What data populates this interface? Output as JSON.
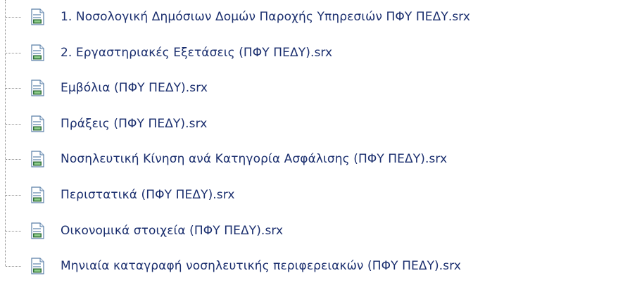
{
  "tree": {
    "items": [
      {
        "label": "1. Νοσολογική Δημόσιων Δομών Παροχής Υπηρεσιών ΠΦΥ ΠΕΔΥ.srx",
        "icon": "report-file-icon"
      },
      {
        "label": "2. Εργαστηριακές Εξετάσεις (ΠΦΥ ΠΕΔΥ).srx",
        "icon": "report-file-icon"
      },
      {
        "label": "Εμβόλια (ΠΦΥ ΠΕΔΥ).srx",
        "icon": "report-file-icon"
      },
      {
        "label": "Πράξεις (ΠΦΥ ΠΕΔΥ).srx",
        "icon": "report-file-icon"
      },
      {
        "label": "Νοσηλευτική Κίνηση ανά Κατηγορία Ασφάλισης (ΠΦΥ ΠΕΔΥ).srx",
        "icon": "report-file-icon"
      },
      {
        "label": "Περιστατικά (ΠΦΥ ΠΕΔΥ).srx",
        "icon": "report-file-icon"
      },
      {
        "label": "Οικονομικά στοιχεία (ΠΦΥ ΠΕΔΥ).srx",
        "icon": "report-file-icon"
      },
      {
        "label": "Μηνιαία καταγραφή νοσηλευτικής περιφερειακών (ΠΦΥ ΠΕΔΥ).srx",
        "icon": "report-file-icon"
      }
    ]
  },
  "colors": {
    "text": "#1a2e6e",
    "tree_line": "#8a8a8a",
    "icon_body": "#ffffff",
    "icon_border": "#5a7fa8",
    "icon_accent": "#2f6f3a"
  }
}
